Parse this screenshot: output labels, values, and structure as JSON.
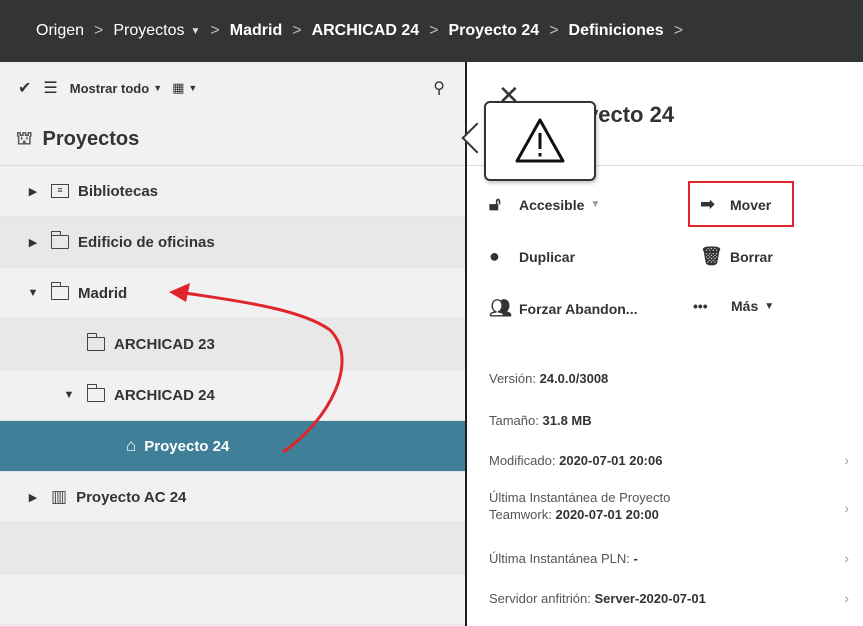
{
  "breadcrumb": [
    {
      "label": "Origen",
      "bold": false,
      "caret": false
    },
    {
      "label": "Proyectos",
      "bold": false,
      "caret": true
    },
    {
      "label": "Madrid",
      "bold": true,
      "caret": false
    },
    {
      "label": "ARCHICAD 24",
      "bold": true,
      "caret": false
    },
    {
      "label": "Proyecto 24",
      "bold": true,
      "caret": false
    },
    {
      "label": "Definiciones",
      "bold": true,
      "caret": false
    }
  ],
  "toolbar": {
    "show_all_label": "Mostrar todo"
  },
  "tree": {
    "header": "Proyectos",
    "items": [
      {
        "label": "Bibliotecas",
        "level": 0,
        "expanded": false
      },
      {
        "label": "Edificio de oficinas",
        "level": 0,
        "expanded": false
      },
      {
        "label": "Madrid",
        "level": 0,
        "expanded": true
      },
      {
        "label": "ARCHICAD 23",
        "level": 1
      },
      {
        "label": "ARCHICAD 24",
        "level": 1,
        "expanded": true
      },
      {
        "label": "Proyecto 24",
        "level": 2,
        "selected": true
      },
      {
        "label": "Proyecto AC 24",
        "level": 0,
        "expanded": false
      }
    ]
  },
  "detail": {
    "title": "yecto 24",
    "actions": {
      "access": "Accesible",
      "move": "Mover",
      "duplicate": "Duplicar",
      "delete": "Borrar",
      "force_leave": "Forzar Abandon...",
      "more": "Más"
    },
    "info": {
      "version_label": "Versión:",
      "version_value": "24.0.0/3008",
      "size_label": "Tamaño:",
      "size_value": "31.8 MB",
      "modified_label": "Modificado:",
      "modified_value": "2020-07-01 20:06",
      "snapshot_label_1": "Última Instantánea de Proyecto",
      "snapshot_label_2": "Teamwork:",
      "snapshot_value": "2020-07-01 20:00",
      "pln_label": "Última Instantánea PLN:",
      "pln_value": "-",
      "host_label": "Servidor anfitrión:",
      "host_value": "Server-2020-07-01"
    }
  },
  "colors": {
    "topbar": "#333436",
    "selected_row": "#3f7f98",
    "highlight_box": "#e0252b",
    "arrow": "#e0252b"
  }
}
